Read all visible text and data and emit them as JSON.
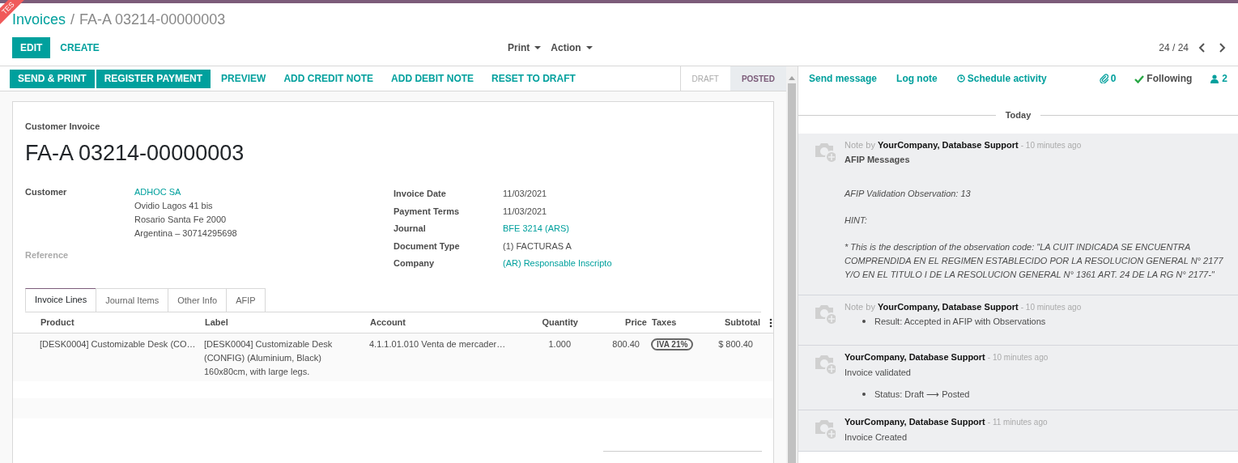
{
  "ribbon": "TES",
  "breadcrumb": {
    "parent": "Invoices",
    "separator": "/",
    "current": "FA-A 03214-00000003"
  },
  "main_buttons": [
    {
      "label": "EDIT",
      "primary": true
    },
    {
      "label": "CREATE",
      "primary": false
    }
  ],
  "dropdowns": [
    "Print",
    "Action"
  ],
  "pager": "24 / 24",
  "header_buttons": [
    {
      "label": "SEND & PRINT",
      "primary": true
    },
    {
      "label": "REGISTER PAYMENT",
      "primary": true
    },
    {
      "label": "PREVIEW",
      "primary": false
    },
    {
      "label": "ADD CREDIT NOTE",
      "primary": false
    },
    {
      "label": "ADD DEBIT NOTE",
      "primary": false
    },
    {
      "label": "RESET TO DRAFT",
      "primary": false
    }
  ],
  "statuses": [
    {
      "label": "DRAFT",
      "selected": false
    },
    {
      "label": "POSTED",
      "selected": true
    }
  ],
  "sheet": {
    "type": "Customer Invoice",
    "name": "FA-A 03214-00000003",
    "left_fields": [
      {
        "label": "Customer",
        "link": "ADHOC SA",
        "lines": [
          "Ovidio Lagos 41 bis",
          "Rosario Santa Fe 2000",
          "Argentina – 30714295698"
        ],
        "muted": false
      },
      {
        "label": "Reference",
        "muted": true
      }
    ],
    "right_fields": [
      {
        "label": "Invoice Date",
        "value": "11/03/2021",
        "kind": "text"
      },
      {
        "label": "Payment Terms",
        "value": "11/03/2021",
        "kind": "text"
      },
      {
        "label": "Journal",
        "value": "BFE 3214 (ARS)",
        "kind": "link"
      },
      {
        "label": "Document Type",
        "value": "(1) FACTURAS A",
        "kind": "text"
      },
      {
        "label": "Company",
        "value": "(AR) Responsable Inscripto",
        "kind": "link"
      }
    ],
    "tabs": [
      {
        "label": "Invoice Lines",
        "selected": true
      },
      {
        "label": "Journal Items",
        "selected": false
      },
      {
        "label": "Other Info",
        "selected": false
      },
      {
        "label": "AFIP",
        "selected": false
      }
    ],
    "table": {
      "columns": [
        "Product",
        "Label",
        "Account",
        "Quantity",
        "Price",
        "Taxes",
        "Subtotal"
      ],
      "rows": [
        {
          "product": "[DESK0004] Customizable Desk (CO…",
          "label": "[DESK0004] Customizable Desk (CONFIG) (Aluminium, Black) 160x80cm, with large legs.",
          "account": "4.1.1.01.010 Venta de mercader…",
          "quantity": "1.000",
          "price": "800.40",
          "taxes": [
            "IVA 21%"
          ],
          "subtotal": "$ 800.40"
        }
      ]
    }
  },
  "chatter": {
    "actions": [
      "Send message",
      "Log note",
      "Schedule activity"
    ],
    "attachments": "0",
    "following": "Following",
    "followers": "2",
    "date": "Today",
    "messages": [
      {
        "prefix": "Note by",
        "author": "YourCompany, Database Support",
        "time": "- 10 minutes ago",
        "body": [
          {
            "kind": "subject",
            "text": "AFIP Messages"
          },
          {
            "kind": "italic",
            "text": "AFIP Validation Observation: 13"
          },
          {
            "kind": "italic",
            "text": "HINT:"
          },
          {
            "kind": "italic",
            "text": "* This is the description of the observation code: \"LA CUIT INDICADA SE ENCUENTRA COMPRENDIDA EN EL REGIMEN ESTABLECIDO POR LA RESOLUCION GENERAL N° 2177 Y/O EN EL TITULO I DE LA RESOLUCION GENERAL N° 1361 ART. 24 DE LA RG N° 2177-\""
          }
        ]
      },
      {
        "prefix": "Note by",
        "author": "YourCompany, Database Support",
        "time": "- 10 minutes ago",
        "body": [
          {
            "kind": "bullet",
            "text": "Result: Accepted in AFIP with Observations"
          }
        ]
      },
      {
        "author": "YourCompany, Database Support",
        "time": "- 10 minutes ago",
        "body": [
          {
            "kind": "text",
            "text": "Invoice validated"
          },
          {
            "kind": "bullet",
            "text": "Status: Draft ⟶ Posted"
          }
        ]
      },
      {
        "author": "YourCompany, Database Support",
        "time": "- 11 minutes ago",
        "body": [
          {
            "kind": "text",
            "text": "Invoice Created"
          }
        ]
      }
    ]
  }
}
